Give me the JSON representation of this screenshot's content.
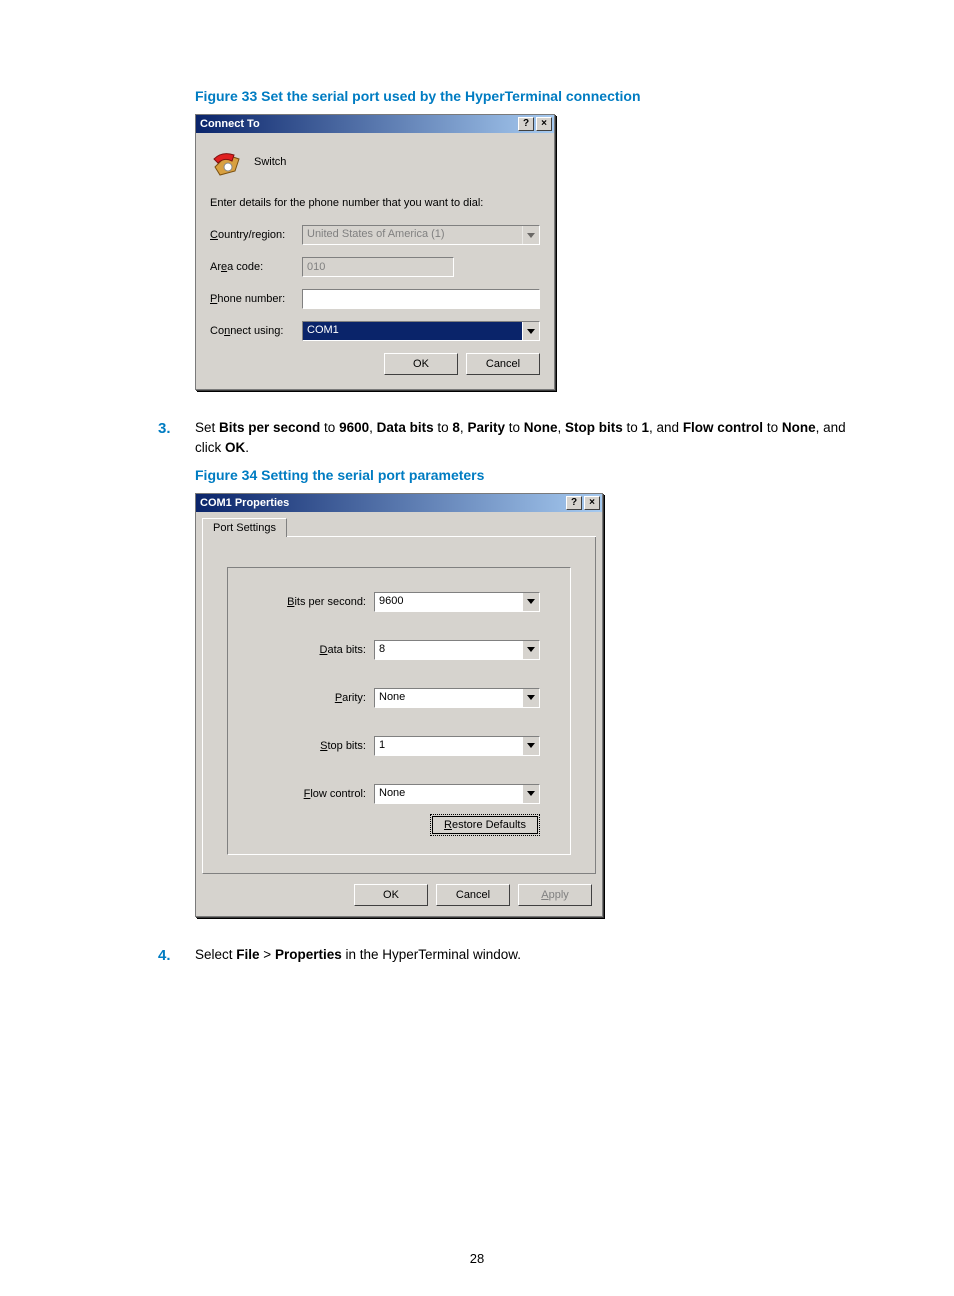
{
  "page_number": "28",
  "fig33": {
    "caption": "Figure 33 Set the serial port used by the HyperTerminal connection",
    "title": "Connect To",
    "icon_label": "Switch",
    "instruction": "Enter details for the phone number that you want to dial:",
    "country_label_pre": "C",
    "country_label_post": "ountry/region:",
    "country_value": "United States of America (1)",
    "area_label_pre": "Ar",
    "area_label_u": "e",
    "area_label_post": "a code:",
    "area_value": "010",
    "phone_label_u": "P",
    "phone_label_post": "hone number:",
    "phone_value": "",
    "connect_label_pre": "Co",
    "connect_label_u": "n",
    "connect_label_post": "nect using:",
    "connect_value": "COM1",
    "ok": "OK",
    "cancel": "Cancel"
  },
  "step3": {
    "num": "3.",
    "t1": "Set ",
    "b1": "Bits per second",
    "t2": " to ",
    "b2": "9600",
    "t3": ", ",
    "b3": "Data bits",
    "t4": " to ",
    "b4": "8",
    "t5": ", ",
    "b5": "Parity",
    "t6": " to ",
    "b6": "None",
    "t7": ", ",
    "b7": "Stop bits",
    "t8": " to ",
    "b8": "1",
    "t9": ", and ",
    "b9": "Flow control",
    "t10": " to ",
    "b10": "None",
    "t11": ", and click ",
    "b11": "OK",
    "t12": "."
  },
  "fig34": {
    "caption": "Figure 34 Setting the serial port parameters",
    "title": "COM1 Properties",
    "tab": "Port Settings",
    "bits_label_u": "B",
    "bits_label_post": "its per second:",
    "bits_value": "9600",
    "data_label_u": "D",
    "data_label_post": "ata bits:",
    "data_value": "8",
    "parity_label_u": "P",
    "parity_label_post": "arity:",
    "parity_value": "None",
    "stop_label_u": "S",
    "stop_label_post": "top bits:",
    "stop_value": "1",
    "flow_label_u": "F",
    "flow_label_post": "low control:",
    "flow_value": "None",
    "restore_u": "R",
    "restore_post": "estore Defaults",
    "ok": "OK",
    "cancel": "Cancel",
    "apply_u": "A",
    "apply_post": "pply"
  },
  "step4": {
    "num": "4.",
    "t1": "Select ",
    "b1": "File",
    "t2": " > ",
    "b2": "Properties",
    "t3": " in the HyperTerminal window."
  }
}
